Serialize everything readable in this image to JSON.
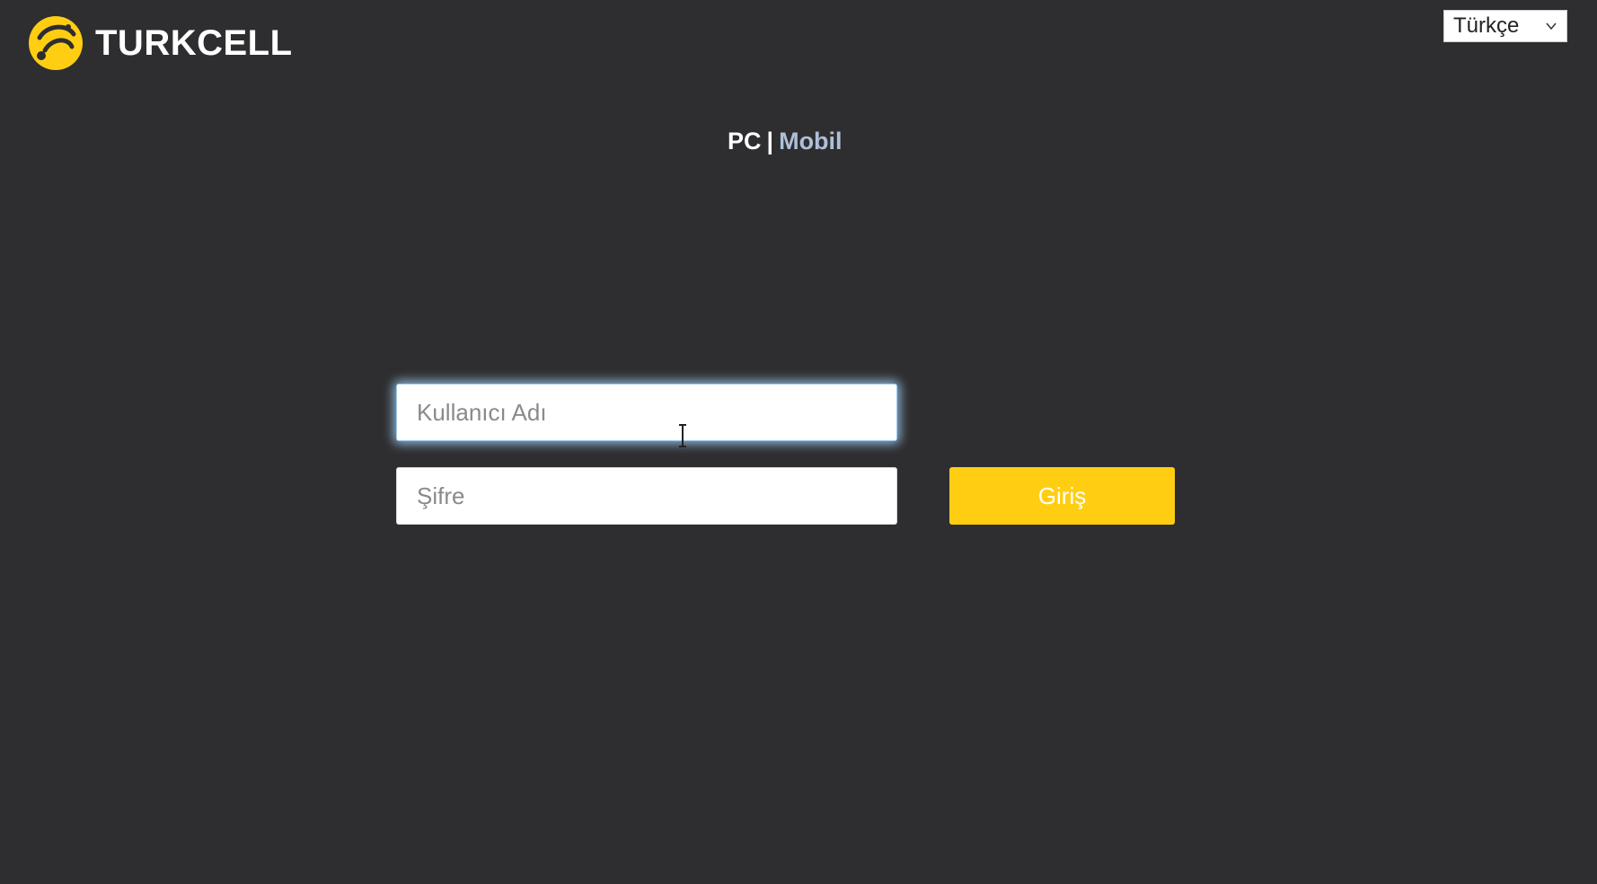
{
  "header": {
    "logo_text": "TURKCELL",
    "language_selected": "Türkçe",
    "brand_color": "#ffce12"
  },
  "mode_switch": {
    "pc_label": "PC",
    "separator": "|",
    "mobile_label": "Mobil"
  },
  "login_form": {
    "username_placeholder": "Kullanıcı Adı",
    "password_placeholder": "Şifre",
    "submit_label": "Giriş"
  },
  "icons": {
    "logo": "turkcell-logo-icon",
    "dropdown": "chevron-down-icon",
    "cursor": "text-cursor-icon"
  }
}
